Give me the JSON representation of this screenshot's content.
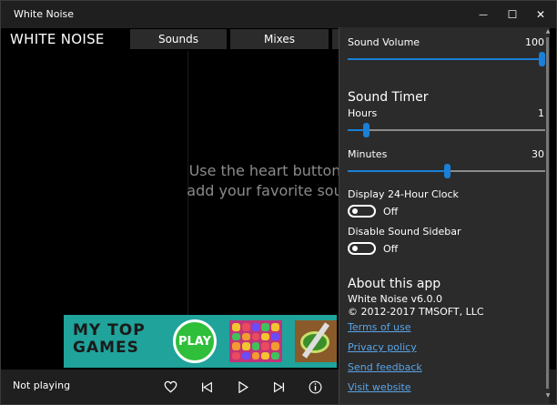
{
  "window": {
    "title": "White Noise",
    "minimize_glyph": "—",
    "maximize_glyph": "☐",
    "close_glyph": "✕"
  },
  "header": {
    "brand": "WHITE NOISE",
    "tabs": [
      {
        "label": "Sounds"
      },
      {
        "label": "Mixes"
      },
      {
        "label": ""
      }
    ]
  },
  "main": {
    "hint_line1": "Use the heart button",
    "hint_line2": "add your favorite sou"
  },
  "ad": {
    "title_line1": "My Top",
    "title_line2": "Games",
    "play_label": "PLAY"
  },
  "player": {
    "status": "Not playing"
  },
  "settings": {
    "volume": {
      "label": "Sound Volume",
      "value": "100",
      "fraction": 1.0
    },
    "timer_heading": "Sound Timer",
    "hours": {
      "label": "Hours",
      "value": "1",
      "fraction": 0.09
    },
    "minutes": {
      "label": "Minutes",
      "value": "30",
      "fraction": 0.5
    },
    "clock24": {
      "label": "Display 24-Hour Clock",
      "state": "Off"
    },
    "sidebar": {
      "label": "Disable Sound Sidebar",
      "state": "Off"
    },
    "about": {
      "heading": "About this app",
      "version": "White Noise v6.0.0",
      "copyright": "© 2012-2017 TMSOFT, LLC",
      "links": [
        "Terms of use",
        "Privacy policy",
        "Send feedback",
        "Visit website"
      ]
    }
  },
  "colors": {
    "accent": "#1a7fd6",
    "link": "#5aa4e8",
    "flyout_bg": "#2b2b2b",
    "ad_bg": "#1fa39b",
    "ad_play": "#2fbf3a"
  },
  "icons": {
    "heart": "heart-icon",
    "previous": "skip-previous-icon",
    "play": "play-icon",
    "next": "skip-next-icon",
    "info": "info-icon"
  }
}
